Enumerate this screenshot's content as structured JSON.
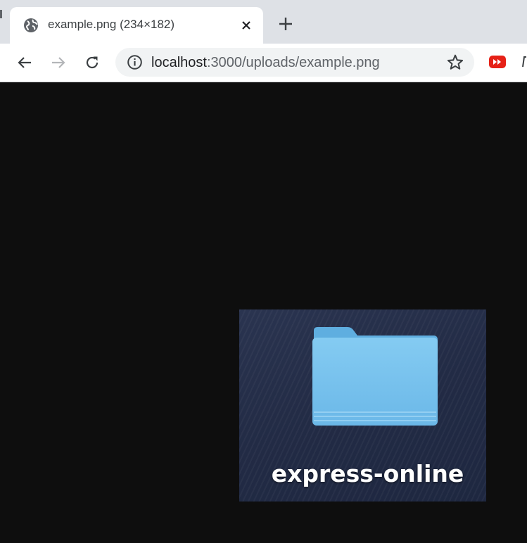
{
  "browser": {
    "tab": {
      "title": "example.png (234×182)",
      "icon": "globe-icon",
      "close_icon": "close-icon"
    },
    "new_tab_icon": "plus-icon",
    "toolbar": {
      "back_icon": "back-arrow-icon",
      "forward_icon": "forward-arrow-icon",
      "reload_icon": "reload-icon",
      "info_icon": "info-icon",
      "url_host": "localhost",
      "url_rest": ":3000/uploads/example.png",
      "star_icon": "star-icon",
      "extension_icon": "youtube-extension-icon"
    }
  },
  "content": {
    "image": {
      "folder_icon": "folder-icon",
      "label": "express-online"
    }
  },
  "colors": {
    "page_background": "#0e0e0e",
    "tabstrip": "#dee1e6",
    "folder_blue": "#7fc6f0",
    "extension_red": "#e62117"
  }
}
